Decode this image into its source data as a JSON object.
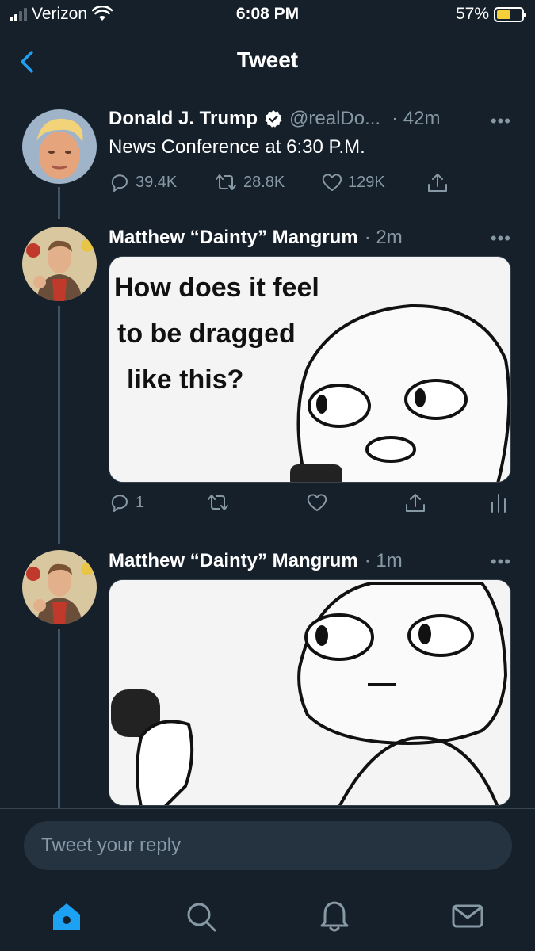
{
  "status_bar": {
    "carrier": "Verizon",
    "time": "6:08 PM",
    "battery": "57%",
    "battery_level": 0.57
  },
  "nav": {
    "title": "Tweet",
    "back_icon": "chevron-left-icon"
  },
  "main_tweet": {
    "name": "Donald J. Trump",
    "handle": "@realDo...",
    "time": "· 42m",
    "text": "News Conference at 6:30 P.M.",
    "replies": "39.4K",
    "retweets": "28.8K",
    "likes": "129K",
    "more": "•••"
  },
  "reply_1": {
    "name": "Matthew “Dainty” Mangrum",
    "time": "· 2m",
    "replies": "1",
    "more": "•••",
    "image_text": [
      "How does it feel",
      "to be dragged",
      "like this?"
    ]
  },
  "reply_2": {
    "name": "Matthew “Dainty” Mangrum",
    "time": "· 1m",
    "more": "•••"
  },
  "composer": {
    "placeholder": "Tweet your reply"
  },
  "tabbar": {
    "items": [
      "home-icon",
      "search-icon",
      "notifications-icon",
      "messages-icon"
    ]
  },
  "colors": {
    "background": "#15202b",
    "accent": "#1da1f2",
    "secondary_text": "#8899a6",
    "divider": "#38444d"
  }
}
